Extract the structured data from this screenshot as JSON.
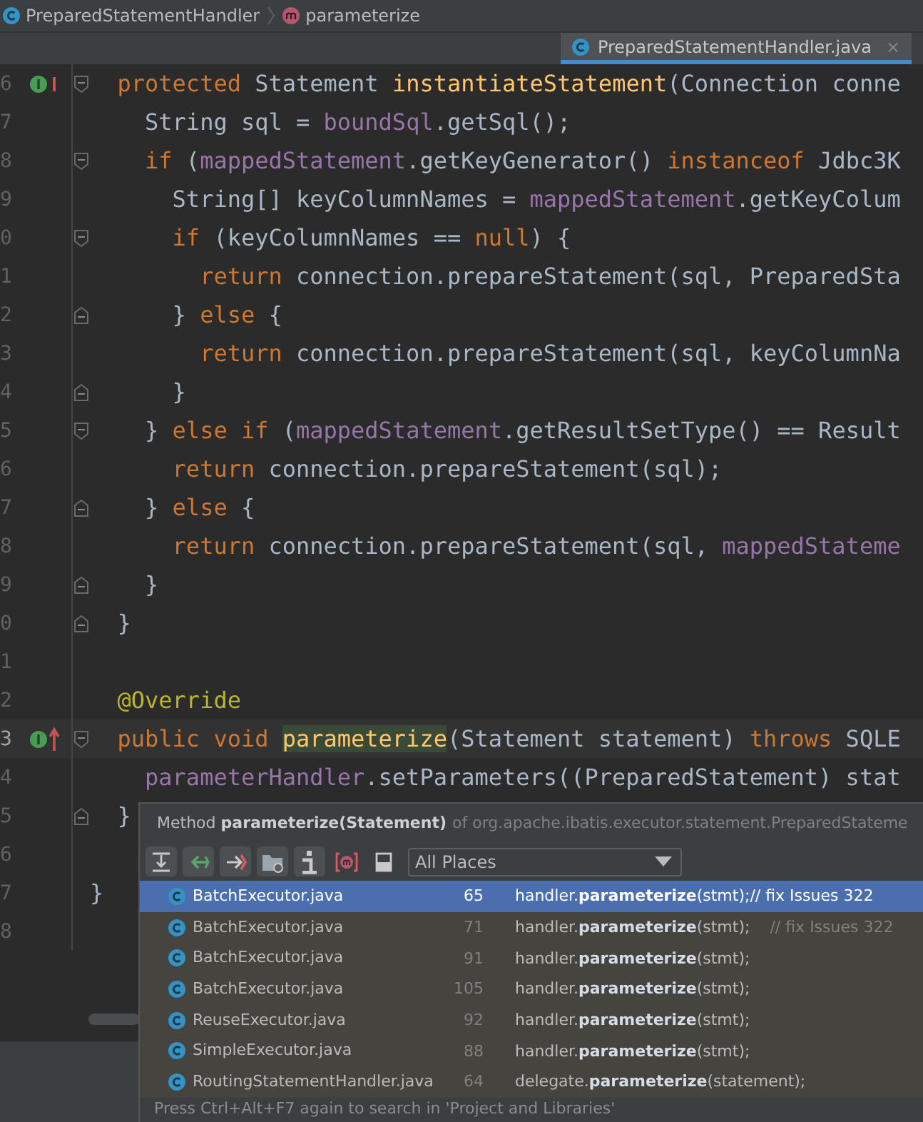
{
  "breadcrumb": [
    {
      "kind": "class",
      "label": "PreparedStatementHandler"
    },
    {
      "kind": "method",
      "label": "parameterize"
    }
  ],
  "tabs": [
    {
      "label": "PreparedStatementHandler.java",
      "selected": true,
      "close": "×"
    }
  ],
  "editor": {
    "lines": [
      {
        "number": "6",
        "implements": true,
        "overrides": false,
        "fold_start": true,
        "fold_end": false,
        "current": false,
        "segments": [
          {
            "kind": "kw",
            "text": "  protected"
          },
          {
            "kind": "p",
            "text": " Statement "
          },
          {
            "kind": "decl",
            "text": "instantiateStatement"
          },
          {
            "kind": "p",
            "text": "(Connection conne"
          }
        ]
      },
      {
        "number": "7",
        "implements": false,
        "overrides": false,
        "fold_start": false,
        "fold_end": false,
        "current": false,
        "segments": [
          {
            "kind": "p",
            "text": "    String sql = "
          },
          {
            "kind": "field",
            "text": "boundSql"
          },
          {
            "kind": "p",
            "text": ".getSql();"
          }
        ]
      },
      {
        "number": "8",
        "implements": false,
        "overrides": false,
        "fold_start": true,
        "fold_end": false,
        "current": false,
        "segments": [
          {
            "kind": "kw",
            "text": "    if"
          },
          {
            "kind": "p",
            "text": " ("
          },
          {
            "kind": "field",
            "text": "mappedStatement"
          },
          {
            "kind": "p",
            "text": ".getKeyGenerator() "
          },
          {
            "kind": "kw",
            "text": "instanceof"
          },
          {
            "kind": "p",
            "text": " Jdbc3K"
          }
        ]
      },
      {
        "number": "9",
        "implements": false,
        "overrides": false,
        "fold_start": false,
        "fold_end": false,
        "current": false,
        "segments": [
          {
            "kind": "p",
            "text": "      String[] keyColumnNames = "
          },
          {
            "kind": "field",
            "text": "mappedStatement"
          },
          {
            "kind": "p",
            "text": ".getKeyColum"
          }
        ]
      },
      {
        "number": "0",
        "implements": false,
        "overrides": false,
        "fold_start": true,
        "fold_end": false,
        "current": false,
        "segments": [
          {
            "kind": "kw",
            "text": "      if"
          },
          {
            "kind": "p",
            "text": " (keyColumnNames == "
          },
          {
            "kind": "kw",
            "text": "null"
          },
          {
            "kind": "p",
            "text": ") {"
          }
        ]
      },
      {
        "number": "1",
        "implements": false,
        "overrides": false,
        "fold_start": false,
        "fold_end": false,
        "current": false,
        "segments": [
          {
            "kind": "kw",
            "text": "        return"
          },
          {
            "kind": "p",
            "text": " connection.prepareStatement(sql, PreparedSta"
          }
        ]
      },
      {
        "number": "2",
        "implements": false,
        "overrides": false,
        "fold_start": false,
        "fold_end": true,
        "current": false,
        "segments": [
          {
            "kind": "p",
            "text": "      } "
          },
          {
            "kind": "kw",
            "text": "else"
          },
          {
            "kind": "p",
            "text": " {"
          }
        ]
      },
      {
        "number": "3",
        "implements": false,
        "overrides": false,
        "fold_start": false,
        "fold_end": false,
        "current": false,
        "segments": [
          {
            "kind": "kw",
            "text": "        return"
          },
          {
            "kind": "p",
            "text": " connection.prepareStatement(sql, keyColumnNa"
          }
        ]
      },
      {
        "number": "4",
        "implements": false,
        "overrides": false,
        "fold_start": false,
        "fold_end": true,
        "current": false,
        "segments": [
          {
            "kind": "p",
            "text": "      }"
          }
        ]
      },
      {
        "number": "5",
        "implements": false,
        "overrides": false,
        "fold_start": true,
        "fold_end": false,
        "current": false,
        "segments": [
          {
            "kind": "p",
            "text": "    } "
          },
          {
            "kind": "kw",
            "text": "else if"
          },
          {
            "kind": "p",
            "text": " ("
          },
          {
            "kind": "field",
            "text": "mappedStatement"
          },
          {
            "kind": "p",
            "text": ".getResultSetType() == Result"
          }
        ]
      },
      {
        "number": "6",
        "implements": false,
        "overrides": false,
        "fold_start": false,
        "fold_end": false,
        "current": false,
        "segments": [
          {
            "kind": "kw",
            "text": "      return"
          },
          {
            "kind": "p",
            "text": " connection.prepareStatement(sql);"
          }
        ]
      },
      {
        "number": "7",
        "implements": false,
        "overrides": false,
        "fold_start": false,
        "fold_end": true,
        "current": false,
        "segments": [
          {
            "kind": "p",
            "text": "    } "
          },
          {
            "kind": "kw",
            "text": "else"
          },
          {
            "kind": "p",
            "text": " {"
          }
        ]
      },
      {
        "number": "8",
        "implements": false,
        "overrides": false,
        "fold_start": false,
        "fold_end": false,
        "current": false,
        "segments": [
          {
            "kind": "kw",
            "text": "      return"
          },
          {
            "kind": "p",
            "text": " connection.prepareStatement(sql, "
          },
          {
            "kind": "field",
            "text": "mappedStateme"
          }
        ]
      },
      {
        "number": "9",
        "implements": false,
        "overrides": false,
        "fold_start": false,
        "fold_end": true,
        "current": false,
        "segments": [
          {
            "kind": "p",
            "text": "    }"
          }
        ]
      },
      {
        "number": "0",
        "implements": false,
        "overrides": false,
        "fold_start": false,
        "fold_end": true,
        "current": false,
        "segments": [
          {
            "kind": "p",
            "text": "  }"
          }
        ]
      },
      {
        "number": "1",
        "implements": false,
        "overrides": false,
        "fold_start": false,
        "fold_end": false,
        "current": false
      },
      {
        "number": "2",
        "implements": false,
        "overrides": false,
        "fold_start": false,
        "fold_end": false,
        "current": false,
        "segments": [
          {
            "kind": "ann",
            "text": "  @Override"
          }
        ]
      },
      {
        "number": "3",
        "implements": false,
        "overrides": true,
        "fold_start": true,
        "fold_end": false,
        "current": true,
        "segments": [
          {
            "kind": "kw",
            "text": "  public void "
          },
          {
            "kind": "decl-hl",
            "text": "parameterize"
          },
          {
            "kind": "p",
            "text": "(Statement statement) "
          },
          {
            "kind": "kw",
            "text": "throws"
          },
          {
            "kind": "p",
            "text": " SQLE"
          }
        ]
      },
      {
        "number": "4",
        "implements": false,
        "overrides": false,
        "fold_start": false,
        "fold_end": false,
        "current": false,
        "segments": [
          {
            "kind": "field",
            "text": "    parameterHandler"
          },
          {
            "kind": "p",
            "text": ".setParameters((PreparedStatement) stat"
          }
        ]
      },
      {
        "number": "5",
        "implements": false,
        "overrides": false,
        "fold_start": false,
        "fold_end": true,
        "current": false,
        "segments": [
          {
            "kind": "p",
            "text": "  }"
          }
        ]
      },
      {
        "number": "6",
        "implements": false,
        "overrides": false,
        "fold_start": false,
        "fold_end": false,
        "current": false
      },
      {
        "number": "7",
        "implements": false,
        "overrides": false,
        "fold_start": false,
        "fold_end": false,
        "current": false,
        "segments": [
          {
            "kind": "p",
            "text": "}"
          }
        ]
      },
      {
        "number": "8",
        "implements": false,
        "overrides": false,
        "fold_start": false,
        "fold_end": false,
        "current": false
      }
    ]
  },
  "usages_popup": {
    "title": "Method **parameterize(Statement)**",
    "qualifier": "of org.apache.ibatis.executor.statement.PreparedStateme",
    "scope": "All Places",
    "rows": [
      {
        "file": "BatchExecutor.java",
        "line": "65",
        "snippet": "handler.**parameterize**(stmt);// fix Issues 322",
        "selected": true
      },
      {
        "file": "BatchExecutor.java",
        "line": "71",
        "snippet": "handler.**parameterize**(stmt);",
        "comment": "// fix Issues 322",
        "selected": false
      },
      {
        "file": "BatchExecutor.java",
        "line": "91",
        "snippet": "handler.**parameterize**(stmt);",
        "selected": false
      },
      {
        "file": "BatchExecutor.java",
        "line": "105",
        "snippet": "handler.**parameterize**(stmt);",
        "selected": false
      },
      {
        "file": "ReuseExecutor.java",
        "line": "92",
        "snippet": "handler.**parameterize**(stmt);",
        "selected": false
      },
      {
        "file": "SimpleExecutor.java",
        "line": "88",
        "snippet": "handler.**parameterize**(stmt);",
        "selected": false
      },
      {
        "file": "RoutingStatementHandler.java",
        "line": "64",
        "snippet": "delegate.**parameterize**(statement);",
        "selected": false
      }
    ],
    "hint": "Press Ctrl+Alt+F7 again to search in 'Project and Libraries'"
  }
}
